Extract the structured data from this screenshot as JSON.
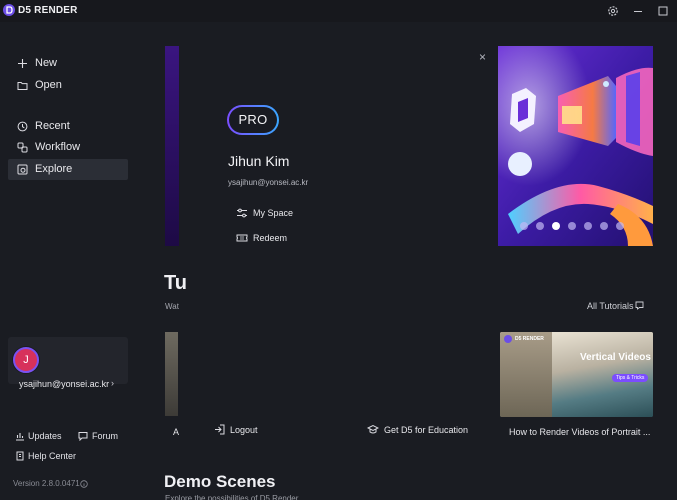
{
  "app": {
    "title": "D5 RENDER"
  },
  "sidebar": {
    "primary": [
      {
        "label": "New",
        "icon": "plus-icon"
      },
      {
        "label": "Open",
        "icon": "folder-icon"
      }
    ],
    "secondary": [
      {
        "label": "Recent",
        "icon": "clock-icon"
      },
      {
        "label": "Workflow",
        "icon": "workflow-icon"
      },
      {
        "label": "Explore",
        "icon": "explore-icon",
        "active": true
      }
    ],
    "account": {
      "avatar_letter": "J",
      "email": "ysajihun@yonsei.ac.kr",
      "chevron": "›"
    },
    "footer": {
      "updates": "Updates",
      "forum": "Forum",
      "help_center": "Help Center",
      "version": "Version 2.8.0.0471"
    }
  },
  "main": {
    "tutorials_heading_fragment": "Tu",
    "tutorials_sub_fragment": "Wat",
    "all_tutorials": "All Tutorials",
    "left_card_fragment": "A",
    "right_card": {
      "caption": "How to Render Videos of Portrait ...",
      "thumb_brand": "D5 RENDER",
      "thumb_title": "Vertical Videos",
      "thumb_tag": "Tips & Tricks"
    },
    "demo_heading": "Demo Scenes",
    "demo_sub_fragment": "Explore the possibilities of D5 Render"
  },
  "account_popup": {
    "badge": "PRO",
    "name": "Jihun Kim",
    "email": "ysajihun@yonsei.ac.kr",
    "my_space": "My Space",
    "redeem": "Redeem",
    "logout": "Logout",
    "education": "Get D5 for Education",
    "close": "×"
  },
  "carousel": {
    "slide_count": 7,
    "active_index": 2
  },
  "colors": {
    "accent": "#7b4dff",
    "background": "#1a1c22",
    "avatar": "#d7315b"
  }
}
